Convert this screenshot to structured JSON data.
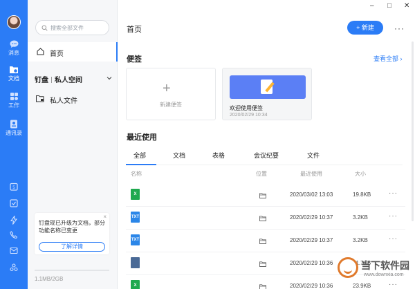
{
  "rail": {
    "items": [
      {
        "label": "消息",
        "icon": "chat-icon"
      },
      {
        "label": "文档",
        "icon": "document-icon"
      },
      {
        "label": "工作",
        "icon": "work-icon"
      },
      {
        "label": "通讯录",
        "icon": "contacts-icon"
      }
    ],
    "bottom_icons": [
      "calendar-icon",
      "check-icon",
      "bolt-icon",
      "phone-icon",
      "mail-icon",
      "apps-icon"
    ],
    "accent": "#2B7CF6"
  },
  "window": {
    "minimize": "–",
    "maximize": "□",
    "close": "✕"
  },
  "sidebar": {
    "search_placeholder": "搜索全部文件",
    "home": "首页",
    "group": {
      "left": "钉盘",
      "right": "私人空间"
    },
    "private_files": "私人文件",
    "promo": {
      "text": "钉盘现已升级为文档，部分功能名称已变更",
      "button": "了解详情",
      "close": "×"
    },
    "storage": "1.1MB/2GB"
  },
  "header": {
    "title": "首页",
    "new_button": "+ 新建",
    "more": "···"
  },
  "notes": {
    "title": "便签",
    "see_all": "查看全部 ›",
    "new_label": "新建便签",
    "plus": "+",
    "card": {
      "name": "欢迎使用便签",
      "date": "2020/02/29 10:34"
    }
  },
  "recent": {
    "title": "最近使用",
    "tabs": [
      "全部",
      "文档",
      "表格",
      "会议纪要",
      "文件"
    ],
    "active_tab": "全部",
    "columns": {
      "name": "名称",
      "location": "位置",
      "recent": "最近使用",
      "size": "大小"
    },
    "rows": [
      {
        "type": "excel",
        "type_label": "X",
        "date": "2020/03/02 13:03",
        "size": "19.8KB"
      },
      {
        "type": "txt",
        "type_label": "TXT",
        "date": "2020/02/29 10:37",
        "size": "3.2KB"
      },
      {
        "type": "txt",
        "type_label": "TXT",
        "date": "2020/02/29 10:37",
        "size": "3.2KB"
      },
      {
        "type": "file",
        "type_label": "",
        "date": "2020/02/29 10:36",
        "size": "31.7KB"
      },
      {
        "type": "excel",
        "type_label": "X",
        "date": "2020/02/29 10:36",
        "size": "23.9KB"
      }
    ],
    "row_more": "···",
    "type_colors": {
      "excel": "#1fa94f",
      "txt": "#2B86E8",
      "file": "#4a6a96"
    }
  },
  "watermark": {
    "main": "当下软件园",
    "sub": "www.downxia.com"
  }
}
